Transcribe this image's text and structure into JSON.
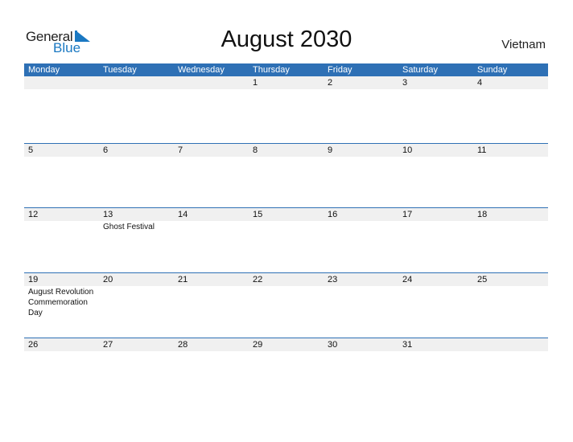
{
  "logo": {
    "general": "General",
    "blue": "Blue"
  },
  "title": "August 2030",
  "country": "Vietnam",
  "colors": {
    "header_bg": "#2e70b5",
    "day_row_bg": "#f0f0f0",
    "logo_blue": "#1a78c2"
  },
  "weekdays": [
    "Monday",
    "Tuesday",
    "Wednesday",
    "Thursday",
    "Friday",
    "Saturday",
    "Sunday"
  ],
  "weeks": [
    {
      "days": [
        "",
        "",
        "",
        "1",
        "2",
        "3",
        "4"
      ],
      "events": [
        "",
        "",
        "",
        "",
        "",
        "",
        ""
      ]
    },
    {
      "days": [
        "5",
        "6",
        "7",
        "8",
        "9",
        "10",
        "11"
      ],
      "events": [
        "",
        "",
        "",
        "",
        "",
        "",
        ""
      ]
    },
    {
      "days": [
        "12",
        "13",
        "14",
        "15",
        "16",
        "17",
        "18"
      ],
      "events": [
        "",
        "Ghost Festival",
        "",
        "",
        "",
        "",
        ""
      ]
    },
    {
      "days": [
        "19",
        "20",
        "21",
        "22",
        "23",
        "24",
        "25"
      ],
      "events": [
        "August Revolution Commemoration Day",
        "",
        "",
        "",
        "",
        "",
        ""
      ]
    },
    {
      "days": [
        "26",
        "27",
        "28",
        "29",
        "30",
        "31",
        ""
      ],
      "events": [
        "",
        "",
        "",
        "",
        "",
        "",
        ""
      ]
    }
  ]
}
